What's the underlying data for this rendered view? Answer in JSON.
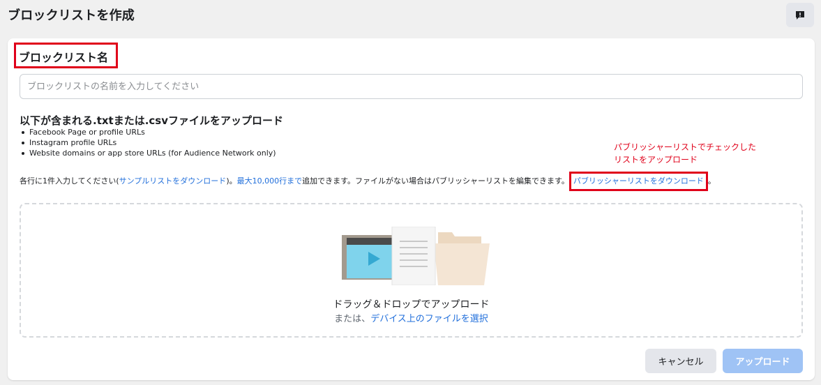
{
  "header": {
    "title": "ブロックリストを作成",
    "feedback_icon": "feedback-icon"
  },
  "form": {
    "name_label": "ブロックリスト名",
    "name_placeholder": "ブロックリストの名前を入力してください",
    "name_value": "",
    "upload_heading": "以下が含まれる.txtまたは.csvファイルをアップロード",
    "formats": [
      "Facebook Page or profile URLs",
      "Instagram profile URLs",
      "Website domains or app store URLs (for Audience Network only)"
    ],
    "annotation_line1": "パブリッシャーリストでチェックした",
    "annotation_line2": "リストをアップロード",
    "instruction_prefix": "各行に1件入力してください(",
    "sample_link": "サンプルリストをダウンロード",
    "instruction_middle1": ")。",
    "max_link": "最大10,000行まで",
    "instruction_middle2": "追加できます。ファイルがない場合はパブリッシャーリストを編集できます。",
    "publisher_link": "パブリッシャーリストをダウンロード",
    "instruction_suffix": "。"
  },
  "dropzone": {
    "title": "ドラッグ＆ドロップでアップロード",
    "sub_prefix": "または、",
    "select_link": "デバイス上のファイルを選択"
  },
  "actions": {
    "cancel_label": "キャンセル",
    "upload_label": "アップロード"
  },
  "colors": {
    "link": "#216fdb",
    "annotation_red": "#e0001a",
    "primary_disabled": "#9fc3f5"
  }
}
